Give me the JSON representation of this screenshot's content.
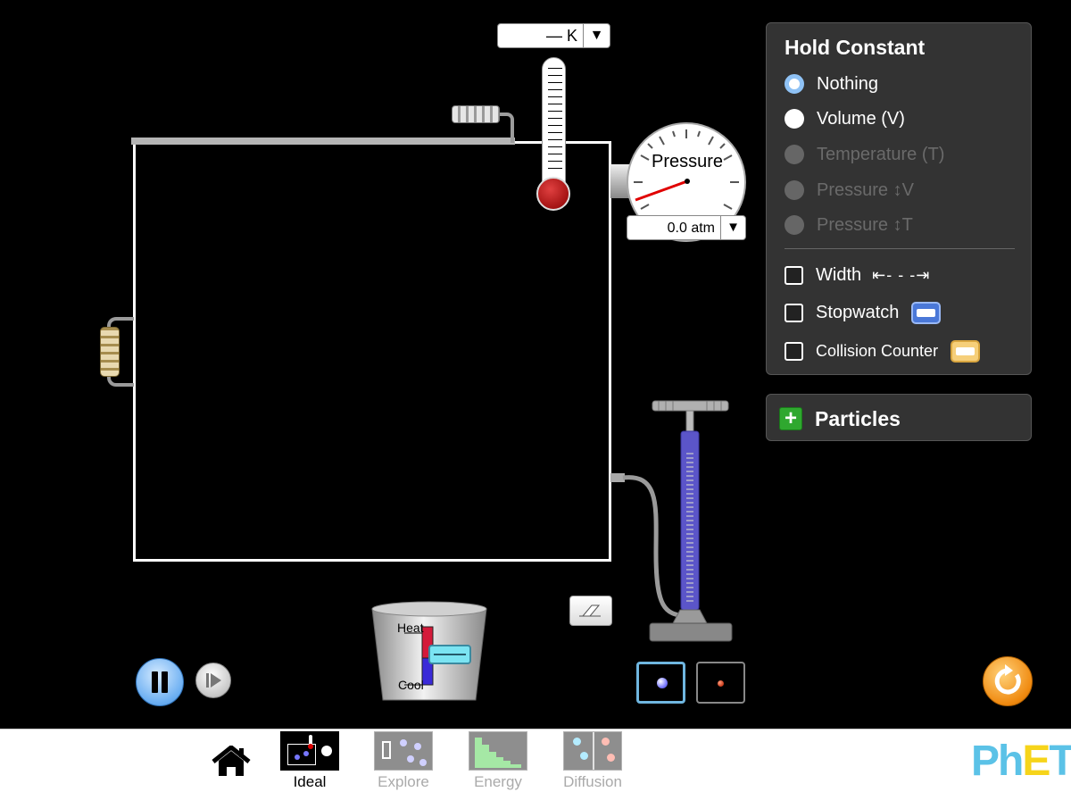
{
  "hold_constant": {
    "title": "Hold Constant",
    "options": [
      {
        "label": "Nothing",
        "state": "selected",
        "enabled": true
      },
      {
        "label": "Volume (V)",
        "state": "unselected",
        "enabled": true
      },
      {
        "label": "Temperature (T)",
        "state": "unselected",
        "enabled": false
      },
      {
        "label": "Pressure ↕V",
        "state": "unselected",
        "enabled": false
      },
      {
        "label": "Pressure ↕T",
        "state": "unselected",
        "enabled": false
      }
    ],
    "checkboxes": [
      {
        "label": "Width",
        "checked": false,
        "icon": "width-arrow-icon",
        "icon_text": "⇤- - -⇥"
      },
      {
        "label": "Stopwatch",
        "checked": false,
        "icon": "stopwatch-icon"
      },
      {
        "label": "Collision Counter",
        "checked": false,
        "icon": "collision-counter-icon"
      }
    ]
  },
  "particles_panel": {
    "title": "Particles",
    "expand_symbol": "+"
  },
  "thermometer": {
    "readout": "— K",
    "dropdown_arrow": "▼"
  },
  "pressure_gauge": {
    "label": "Pressure",
    "readout": "0.0 atm",
    "dropdown_arrow": "▼"
  },
  "heater_cooler": {
    "heat_label": "Heat",
    "cool_label": "Cool"
  },
  "particle_types": [
    {
      "name": "heavy",
      "selected": true,
      "color": "#7b7bff"
    },
    {
      "name": "light",
      "selected": false,
      "color": "#c83a1a"
    }
  ],
  "navbar": {
    "screens": [
      {
        "label": "Ideal",
        "active": true
      },
      {
        "label": "Explore",
        "active": false
      },
      {
        "label": "Energy",
        "active": false
      },
      {
        "label": "Diffusion",
        "active": false
      }
    ],
    "logo": {
      "p": "P",
      "h": "h",
      "e": "E",
      "t": "T"
    }
  },
  "colors": {
    "background": "#000000",
    "panel": "#333333",
    "selected_radio": "#8fc2f5",
    "pump_barrel": "#5b55c9",
    "reset": "#f08a10",
    "logo_blue": "#5bc2e7",
    "logo_yellow": "#f6d41a"
  }
}
